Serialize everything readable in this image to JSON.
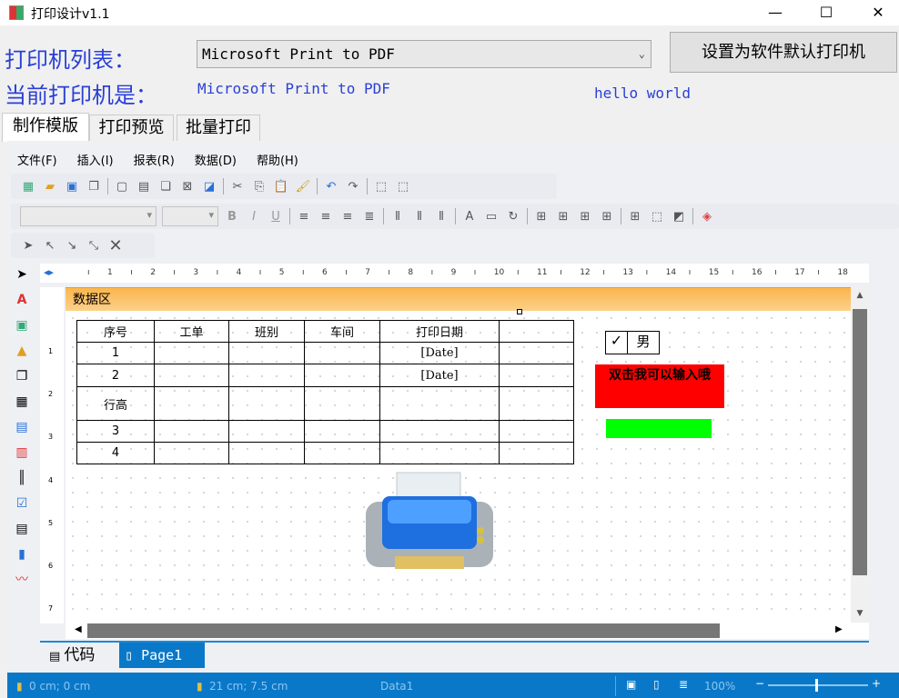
{
  "window": {
    "title": "打印设计v1.1",
    "minimize": "—",
    "maximize": "☐",
    "close": "✕"
  },
  "header": {
    "printer_list_label": "打印机列表：",
    "printer_selected": "Microsoft Print to PDF",
    "set_default_button": "设置为软件默认打印机",
    "current_printer_label": "当前打印机是：",
    "current_printer_value": "Microsoft Print to PDF",
    "hello_text": "hello world"
  },
  "tabs": [
    {
      "label": "制作模版"
    },
    {
      "label": "打印预览"
    },
    {
      "label": "批量打印"
    }
  ],
  "menu": [
    {
      "label": "文件(F)"
    },
    {
      "label": "插入(I)"
    },
    {
      "label": "报表(R)"
    },
    {
      "label": "数据(D)"
    },
    {
      "label": "帮助(H)"
    }
  ],
  "ruler": [
    "1",
    "2",
    "3",
    "4",
    "5",
    "6",
    "7",
    "8",
    "9",
    "10",
    "11",
    "12",
    "13",
    "14",
    "15",
    "16",
    "17",
    "18"
  ],
  "vruler": [
    "1",
    "2",
    "3",
    "4",
    "5",
    "6",
    "7"
  ],
  "band": {
    "label": "数据区"
  },
  "table": {
    "rows": [
      [
        "序号",
        "工单",
        "班别",
        "车间",
        "打印日期",
        ""
      ],
      [
        "1",
        "",
        "",
        "",
        "[Date]",
        ""
      ],
      [
        "2",
        "",
        "",
        "",
        "[Date]",
        ""
      ],
      [
        "行高",
        "",
        "",
        "",
        "",
        ""
      ],
      [
        "3",
        "",
        "",
        "",
        "",
        ""
      ],
      [
        "4",
        "",
        "",
        "",
        "",
        ""
      ]
    ]
  },
  "checkbox": {
    "label": "男",
    "checked": true
  },
  "red_box": {
    "text": "双击我可以输入哦"
  },
  "bottom_tabs": [
    {
      "label": "代码"
    },
    {
      "label": "Page1"
    }
  ],
  "status": {
    "position": "0 cm; 0 cm",
    "size": "21 cm; 7.5 cm",
    "name": "Data1",
    "zoom": "100%"
  },
  "colors": {
    "accent": "#0a78c8",
    "band": "#fbb64e",
    "red": "#ff0000",
    "green": "#00ff00",
    "label_blue": "#2a3fd6"
  }
}
